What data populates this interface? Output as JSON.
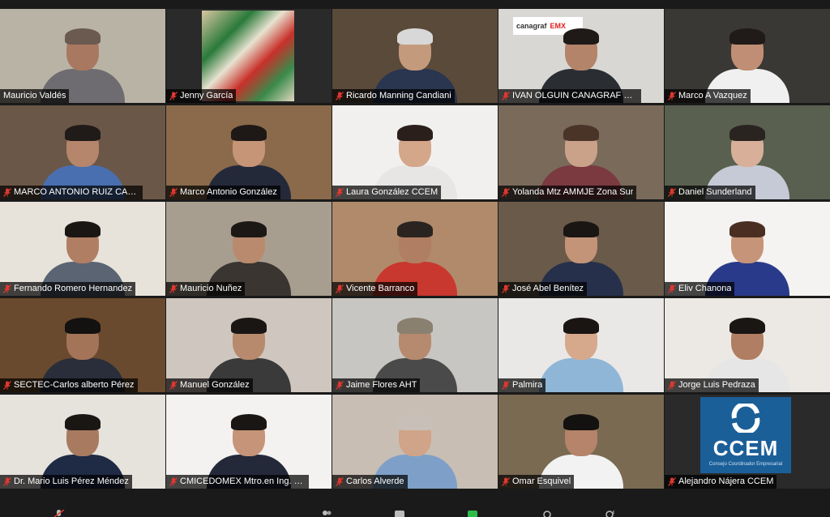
{
  "participants": [
    {
      "name": "Mauricio Valdés",
      "muted": false,
      "active": true,
      "bg": "#b9b3a6",
      "skin": "#a97860",
      "hair": "#6a5a50",
      "shirt": "#6e6c70"
    },
    {
      "name": "Jenny García",
      "muted": true,
      "active": false,
      "bg": "#2a2a2a",
      "skin": "",
      "hair": "",
      "shirt": ""
    },
    {
      "name": "Ricardo Manning Candiani",
      "muted": true,
      "active": false,
      "bg": "#5a4a3a",
      "skin": "#c49a7c",
      "hair": "#d8d8d8",
      "shirt": "#2a3550"
    },
    {
      "name": "IVAN OLGUIN CANAGRAF MEXICO",
      "muted": true,
      "active": false,
      "bg": "#d9d7d3",
      "skin": "#b3846a",
      "hair": "#1f1a17",
      "shirt": "#2a2e33"
    },
    {
      "name": "Marco A Vazquez",
      "muted": true,
      "active": false,
      "bg": "#3a3835",
      "skin": "#c08e74",
      "hair": "#201a18",
      "shirt": "#f0f0f0"
    },
    {
      "name": "MARCO ANTONIO RUIZ CASTRO",
      "muted": true,
      "active": false,
      "bg": "#6b5748",
      "skin": "#b5866c",
      "hair": "#201a18",
      "shirt": "#4a6fb0"
    },
    {
      "name": "Marco Antonio González",
      "muted": true,
      "active": false,
      "bg": "#8a6a4a",
      "skin": "#c69578",
      "hair": "#1e1916",
      "shirt": "#24293a"
    },
    {
      "name": "Laura González CCEM",
      "muted": true,
      "active": false,
      "bg": "#f2f0ee",
      "skin": "#d4a68a",
      "hair": "#2a1f1a",
      "shirt": "#e8e6e4"
    },
    {
      "name": "Yolanda Mtz AMMJE Zona Sur",
      "muted": true,
      "active": false,
      "bg": "#7a6a5a",
      "skin": "#caa28a",
      "hair": "#4a3428",
      "shirt": "#7a3a40"
    },
    {
      "name": "Daniel Sunderland",
      "muted": true,
      "active": false,
      "bg": "#5a6050",
      "skin": "#d8b09a",
      "hair": "#2a2420",
      "shirt": "#c6c9d6"
    },
    {
      "name": "Fernando Romero Hernandez",
      "muted": true,
      "active": false,
      "bg": "#e7e3da",
      "skin": "#b07e62",
      "hair": "#1a1614",
      "shirt": "#5a6472"
    },
    {
      "name": "Mauricio Nuñez",
      "muted": true,
      "active": false,
      "bg": "#a89e90",
      "skin": "#b98a6e",
      "hair": "#1c1816",
      "shirt": "#3a3530"
    },
    {
      "name": "Vicente Barranco",
      "muted": true,
      "active": false,
      "bg": "#b08a6a",
      "skin": "#b07e62",
      "hair": "#2a2420",
      "shirt": "#c8382e"
    },
    {
      "name": "José Abel Benítez",
      "muted": true,
      "active": false,
      "bg": "#6a5a4a",
      "skin": "#c49478",
      "hair": "#1a1614",
      "shirt": "#26304a"
    },
    {
      "name": "Eliv Chanona",
      "muted": true,
      "active": false,
      "bg": "#f4f3f1",
      "skin": "#c69478",
      "hair": "#4a2e22",
      "shirt": "#2a3a8a"
    },
    {
      "name": "SECTEC-Carlos alberto Pérez",
      "muted": true,
      "active": false,
      "bg": "#6a4a2e",
      "skin": "#a47458",
      "hair": "#141210",
      "shirt": "#2a2e3a"
    },
    {
      "name": "Manuel González",
      "muted": true,
      "active": false,
      "bg": "#cfc7bf",
      "skin": "#b78a6e",
      "hair": "#1a1614",
      "shirt": "#3a3a3a"
    },
    {
      "name": "Jaime Flores AHT",
      "muted": true,
      "active": false,
      "bg": "#c8c6c2",
      "skin": "#b68a6e",
      "hair": "#8a8070",
      "shirt": "#4a4a4a"
    },
    {
      "name": "Palmira",
      "muted": true,
      "active": false,
      "bg": "#e9e8e6",
      "skin": "#d6a88c",
      "hair": "#1a1412",
      "shirt": "#8fb6d6"
    },
    {
      "name": "Jorge Luis Pedraza",
      "muted": true,
      "active": false,
      "bg": "#ece9e4",
      "skin": "#b07e62",
      "hair": "#1a1614",
      "shirt": "#e6e6e6"
    },
    {
      "name": "Dr. Mario Luis Pérez Méndez",
      "muted": true,
      "active": false,
      "bg": "#e6e2dc",
      "skin": "#a87a60",
      "hair": "#1a1614",
      "shirt": "#1f2a44"
    },
    {
      "name": "CMICEDOMEX Mtro.en Ing. Luis",
      "muted": true,
      "active": false,
      "bg": "#f3f2f0",
      "skin": "#c69478",
      "hair": "#1a1614",
      "shirt": "#24293a"
    },
    {
      "name": "Carlos Alverde",
      "muted": true,
      "active": false,
      "bg": "#c9beb4",
      "skin": "#d0a488",
      "hair": "#c8c0b8",
      "shirt": "#7ea0c8"
    },
    {
      "name": "Omar Esquivel",
      "muted": true,
      "active": false,
      "bg": "#7a6a52",
      "skin": "#b5846a",
      "hair": "#141210",
      "shirt": "#f2f2f2"
    },
    {
      "name": "Alejandro Nájera CCEM",
      "muted": true,
      "active": false,
      "bg": "#2a2a2a",
      "skin": "",
      "hair": "",
      "shirt": ""
    }
  ],
  "logo": {
    "text": "CCEM",
    "subtitle": "Consejo Coordinador Empresarial",
    "color": "#1b5f99"
  },
  "banner": {
    "left": "canagraf",
    "right": "EMX"
  },
  "colors": {
    "active_border": "#cfd94a",
    "mute_red": "#e0372f",
    "background": "#1a1a1a"
  }
}
